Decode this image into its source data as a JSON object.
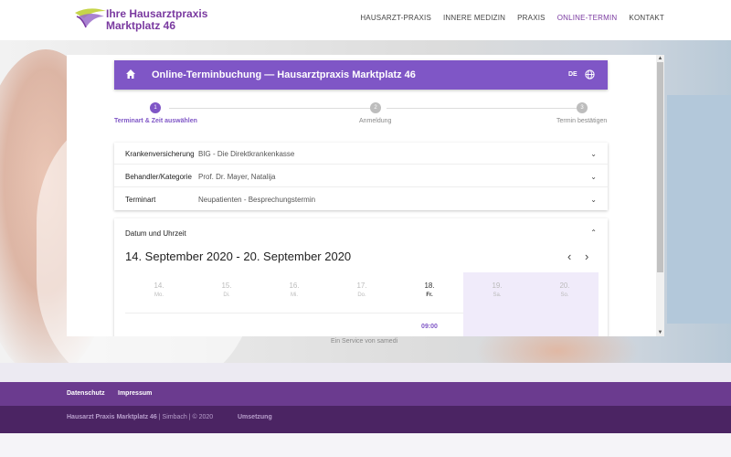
{
  "header": {
    "logo_text": "Ihre Hausarztpraxis\nMarktplatz 46",
    "nav": [
      "HAUSARZT-PRAXIS",
      "INNERE MEDIZIN",
      "PRAXIS",
      "ONLINE-TERMIN",
      "KONTAKT"
    ],
    "active_nav": "ONLINE-TERMIN"
  },
  "hero": {
    "caption": "Ein Service von samedi"
  },
  "booking": {
    "title": "Online-Terminbuchung — Hausarztpraxis Marktplatz 46",
    "language": "DE",
    "steps": [
      {
        "num": "1",
        "label": "Terminart & Zeit auswählen",
        "active": true
      },
      {
        "num": "2",
        "label": "Anmeldung",
        "active": false
      },
      {
        "num": "3",
        "label": "Termin bestätigen",
        "active": false
      }
    ],
    "selections": [
      {
        "label": "Krankenversicherung",
        "value": "BIG - Die Direktkrankenkasse"
      },
      {
        "label": "Behandler/Kategorie",
        "value": "Prof. Dr. Mayer, Natalija"
      },
      {
        "label": "Terminart",
        "value": "Neupatienten - Besprechungstermin"
      }
    ],
    "date_section": {
      "header": "Datum und Uhrzeit",
      "range": "14. September 2020 - 20. September 2020",
      "days": [
        {
          "num": "14.",
          "weekday": "Mo."
        },
        {
          "num": "15.",
          "weekday": "Di."
        },
        {
          "num": "16.",
          "weekday": "Mi."
        },
        {
          "num": "17.",
          "weekday": "Do."
        },
        {
          "num": "18.",
          "weekday": "Fr.",
          "today": true,
          "slot": "09:00"
        },
        {
          "num": "19.",
          "weekday": "Sa."
        },
        {
          "num": "20.",
          "weekday": "So."
        }
      ]
    }
  },
  "footer": {
    "links": [
      "Datenschutz",
      "Impressum"
    ],
    "copyright_bold": "Hausarzt Praxis Marktplatz 46",
    "copyright_rest": " | Simbach | © 2020",
    "credit": "Umsetzung"
  },
  "colors": {
    "accent": "#7f56c6",
    "brand": "#7a3aa0",
    "footer": "#6b3b8f",
    "footer_dark": "#4b2463"
  }
}
